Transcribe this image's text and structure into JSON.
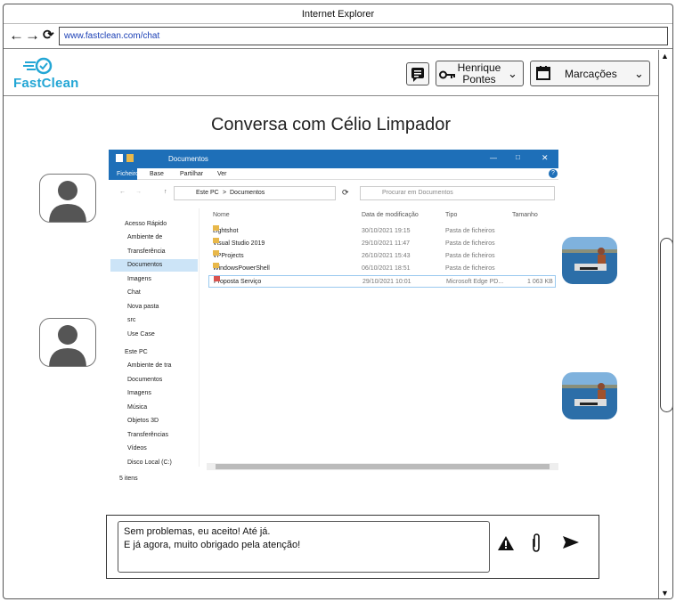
{
  "browser": {
    "title": "Internet Explorer",
    "url": "www.fastclean.com/chat"
  },
  "header": {
    "logo_text": "FastClean",
    "user_name": "Henrique Pontes",
    "bookings_label": "Marcações"
  },
  "conversation": {
    "title": "Conversa com Célio Limpador"
  },
  "explorer": {
    "window_title": "Documentos",
    "ribbon_tabs": [
      "Ficheiro",
      "Base",
      "Partilhar",
      "Ver"
    ],
    "breadcrumb": [
      "Este PC",
      "Documentos"
    ],
    "search_placeholder": "Procurar em Documentos",
    "columns": [
      "Nome",
      "Data de modificação",
      "Tipo",
      "Tamanho"
    ],
    "sidebar": [
      "Acesso Rápido",
      "Ambiente de",
      "Transferência",
      "Documentos",
      "Imagens",
      "Chat",
      "Nova pasta",
      "src",
      "Use Case",
      "Este PC",
      "Ambiente de tra",
      "Documentos",
      "Imagens",
      "Música",
      "Objetos 3D",
      "Transferências",
      "Vídeos",
      "Disco Local (C:)"
    ],
    "files": [
      {
        "name": "Lightshot",
        "date": "30/10/2021 19:15",
        "type": "Pasta de ficheiros",
        "size": ""
      },
      {
        "name": "Visual Studio 2019",
        "date": "29/10/2021 11:47",
        "type": "Pasta de ficheiros",
        "size": ""
      },
      {
        "name": "VPProjects",
        "date": "26/10/2021 15:43",
        "type": "Pasta de ficheiros",
        "size": ""
      },
      {
        "name": "WindowsPowerShell",
        "date": "06/10/2021 18:51",
        "type": "Pasta de ficheiros",
        "size": ""
      },
      {
        "name": "Proposta Serviço",
        "date": "29/10/2021 10:01",
        "type": "Microsoft Edge PD...",
        "size": "1 063 KB"
      }
    ],
    "status": "5 itens"
  },
  "message": {
    "text": "Sem problemas, eu aceito! Até já.\nE já agora, muito obrigado pela atenção!"
  },
  "colors": {
    "brand": "#23a6d5",
    "explorer_title": "#1e6fb8"
  },
  "icons": [
    "back-arrow-icon",
    "forward-arrow-icon",
    "refresh-icon",
    "chat-icon",
    "key-icon",
    "calendar-icon",
    "chevron-down-icon",
    "warning-icon",
    "paperclip-icon",
    "send-icon"
  ]
}
